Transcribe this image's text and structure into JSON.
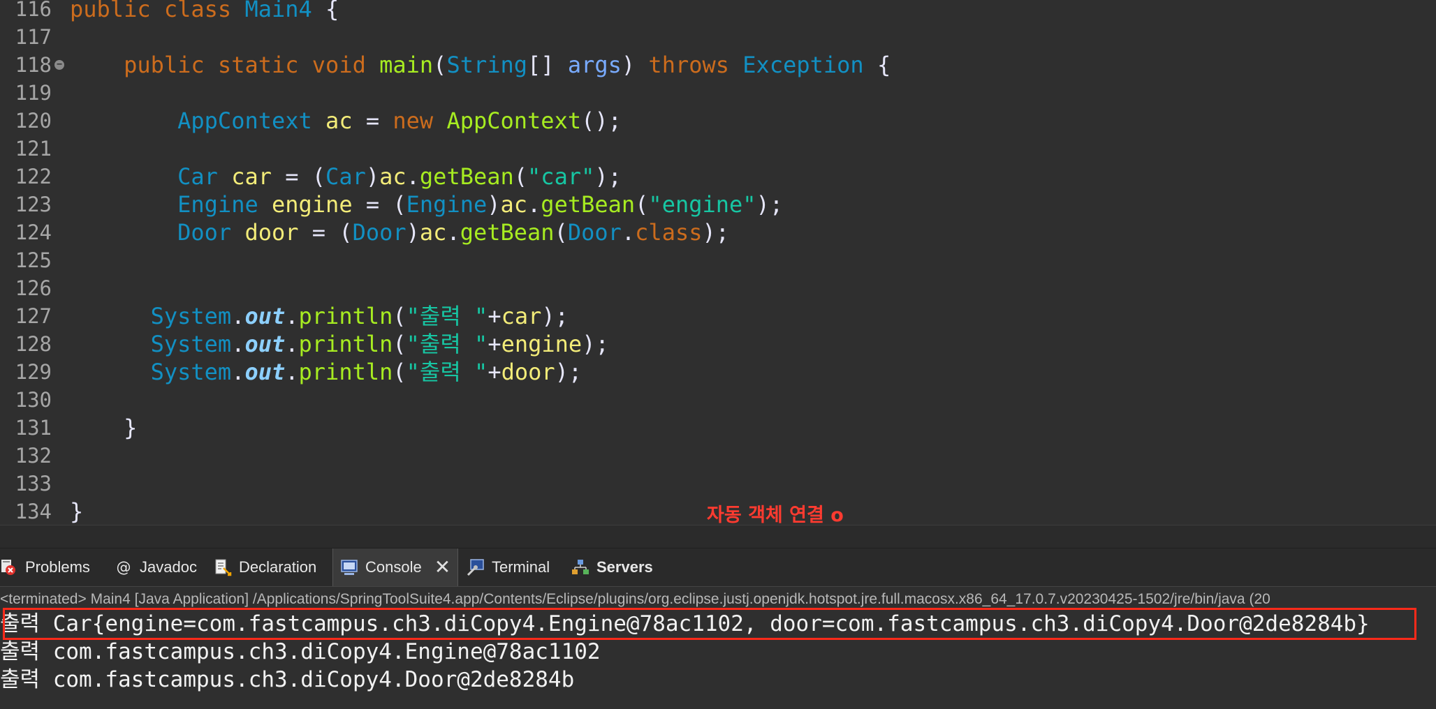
{
  "editor": {
    "lines": [
      {
        "n": "116",
        "tokens": [
          {
            "t": "public class ",
            "c": "kw"
          },
          {
            "t": "Main4",
            "c": "ty"
          },
          {
            "t": " {",
            "c": "pl"
          }
        ]
      },
      {
        "n": "117",
        "tokens": []
      },
      {
        "n": "118",
        "fold": true,
        "tokens": [
          {
            "t": "    public static void ",
            "c": "kw"
          },
          {
            "t": "main",
            "c": "fn"
          },
          {
            "t": "(",
            "c": "pl"
          },
          {
            "t": "String",
            "c": "ty"
          },
          {
            "t": "[] ",
            "c": "pl"
          },
          {
            "t": "args",
            "c": "pm"
          },
          {
            "t": ") ",
            "c": "pl"
          },
          {
            "t": "throws ",
            "c": "kw"
          },
          {
            "t": "Exception",
            "c": "ty"
          },
          {
            "t": " {",
            "c": "pl"
          }
        ]
      },
      {
        "n": "119",
        "tokens": []
      },
      {
        "n": "120",
        "tokens": [
          {
            "t": "        ",
            "c": "pl"
          },
          {
            "t": "AppContext",
            "c": "ty"
          },
          {
            "t": " ",
            "c": "pl"
          },
          {
            "t": "ac",
            "c": "lv"
          },
          {
            "t": " = ",
            "c": "pl"
          },
          {
            "t": "new ",
            "c": "kw"
          },
          {
            "t": "AppContext",
            "c": "fn"
          },
          {
            "t": "();",
            "c": "pl"
          }
        ]
      },
      {
        "n": "121",
        "tokens": []
      },
      {
        "n": "122",
        "tokens": [
          {
            "t": "        ",
            "c": "pl"
          },
          {
            "t": "Car",
            "c": "ty"
          },
          {
            "t": " ",
            "c": "pl"
          },
          {
            "t": "car",
            "c": "lv"
          },
          {
            "t": " = (",
            "c": "pl"
          },
          {
            "t": "Car",
            "c": "ty"
          },
          {
            "t": ")",
            "c": "pl"
          },
          {
            "t": "ac",
            "c": "lv"
          },
          {
            "t": ".",
            "c": "pl"
          },
          {
            "t": "getBean",
            "c": "fn"
          },
          {
            "t": "(",
            "c": "pl"
          },
          {
            "t": "\"car\"",
            "c": "str"
          },
          {
            "t": ");",
            "c": "pl"
          }
        ]
      },
      {
        "n": "123",
        "tokens": [
          {
            "t": "        ",
            "c": "pl"
          },
          {
            "t": "Engine",
            "c": "ty"
          },
          {
            "t": " ",
            "c": "pl"
          },
          {
            "t": "engine",
            "c": "lv"
          },
          {
            "t": " = (",
            "c": "pl"
          },
          {
            "t": "Engine",
            "c": "ty"
          },
          {
            "t": ")",
            "c": "pl"
          },
          {
            "t": "ac",
            "c": "lv"
          },
          {
            "t": ".",
            "c": "pl"
          },
          {
            "t": "getBean",
            "c": "fn"
          },
          {
            "t": "(",
            "c": "pl"
          },
          {
            "t": "\"engine\"",
            "c": "str"
          },
          {
            "t": ");",
            "c": "pl"
          }
        ]
      },
      {
        "n": "124",
        "tokens": [
          {
            "t": "        ",
            "c": "pl"
          },
          {
            "t": "Door",
            "c": "ty"
          },
          {
            "t": " ",
            "c": "pl"
          },
          {
            "t": "door",
            "c": "lv"
          },
          {
            "t": " = (",
            "c": "pl"
          },
          {
            "t": "Door",
            "c": "ty"
          },
          {
            "t": ")",
            "c": "pl"
          },
          {
            "t": "ac",
            "c": "lv"
          },
          {
            "t": ".",
            "c": "pl"
          },
          {
            "t": "getBean",
            "c": "fn"
          },
          {
            "t": "(",
            "c": "pl"
          },
          {
            "t": "Door",
            "c": "ty"
          },
          {
            "t": ".",
            "c": "pl"
          },
          {
            "t": "class",
            "c": "kw"
          },
          {
            "t": ");",
            "c": "pl"
          }
        ]
      },
      {
        "n": "125",
        "tokens": []
      },
      {
        "n": "126",
        "tokens": []
      },
      {
        "n": "127",
        "tokens": [
          {
            "t": "      ",
            "c": "pl"
          },
          {
            "t": "System",
            "c": "ty"
          },
          {
            "t": ".",
            "c": "pl"
          },
          {
            "t": "out",
            "c": "sf"
          },
          {
            "t": ".",
            "c": "pl"
          },
          {
            "t": "println",
            "c": "fn"
          },
          {
            "t": "(",
            "c": "pl"
          },
          {
            "t": "\"출력 \"",
            "c": "str"
          },
          {
            "t": "+",
            "c": "pl"
          },
          {
            "t": "car",
            "c": "lv"
          },
          {
            "t": ");",
            "c": "pl"
          }
        ]
      },
      {
        "n": "128",
        "tokens": [
          {
            "t": "      ",
            "c": "pl"
          },
          {
            "t": "System",
            "c": "ty"
          },
          {
            "t": ".",
            "c": "pl"
          },
          {
            "t": "out",
            "c": "sf"
          },
          {
            "t": ".",
            "c": "pl"
          },
          {
            "t": "println",
            "c": "fn"
          },
          {
            "t": "(",
            "c": "pl"
          },
          {
            "t": "\"출력 \"",
            "c": "str"
          },
          {
            "t": "+",
            "c": "pl"
          },
          {
            "t": "engine",
            "c": "lv"
          },
          {
            "t": ");",
            "c": "pl"
          }
        ]
      },
      {
        "n": "129",
        "tokens": [
          {
            "t": "      ",
            "c": "pl"
          },
          {
            "t": "System",
            "c": "ty"
          },
          {
            "t": ".",
            "c": "pl"
          },
          {
            "t": "out",
            "c": "sf"
          },
          {
            "t": ".",
            "c": "pl"
          },
          {
            "t": "println",
            "c": "fn"
          },
          {
            "t": "(",
            "c": "pl"
          },
          {
            "t": "\"출력 \"",
            "c": "str"
          },
          {
            "t": "+",
            "c": "pl"
          },
          {
            "t": "door",
            "c": "lv"
          },
          {
            "t": ");",
            "c": "pl"
          }
        ]
      },
      {
        "n": "130",
        "tokens": []
      },
      {
        "n": "131",
        "tokens": [
          {
            "t": "    }",
            "c": "pl"
          }
        ]
      },
      {
        "n": "132",
        "tokens": []
      },
      {
        "n": "133",
        "tokens": []
      },
      {
        "n": "134",
        "tokens": [
          {
            "t": "}",
            "c": "pl"
          }
        ]
      }
    ],
    "annotation": "자동 객체 연결 o"
  },
  "tabs": {
    "problems": "Problems",
    "javadoc": "Javadoc",
    "declaration": "Declaration",
    "console": "Console",
    "terminal": "Terminal",
    "servers": "Servers"
  },
  "console": {
    "terminated": "<terminated> Main4 [Java Application] /Applications/SpringToolSuite4.app/Contents/Eclipse/plugins/org.eclipse.justj.openjdk.hotspot.jre.full.macosx.x86_64_17.0.7.v20230425-1502/jre/bin/java  (20",
    "output": [
      "출력 Car{engine=com.fastcampus.ch3.diCopy4.Engine@78ac1102, door=com.fastcampus.ch3.diCopy4.Door@2de8284b}",
      "출력 com.fastcampus.ch3.diCopy4.Engine@78ac1102",
      "출력 com.fastcampus.ch3.diCopy4.Door@2de8284b"
    ]
  }
}
